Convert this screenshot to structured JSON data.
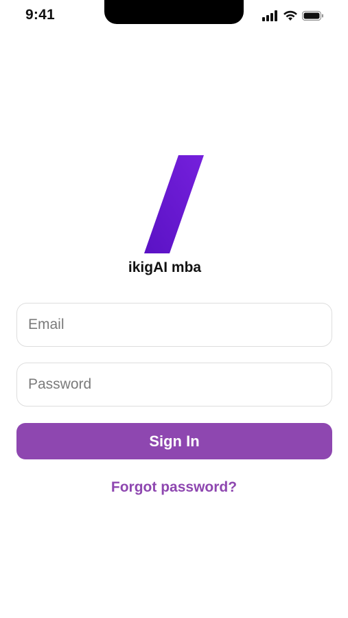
{
  "status_bar": {
    "time": "9:41",
    "icons": [
      "cellular-signal-icon",
      "wifi-icon",
      "battery-icon"
    ]
  },
  "brand": {
    "logo_icon": "slash-logo-icon",
    "name": "ikigAI mba",
    "logo_color": "#6a17d0"
  },
  "login_form": {
    "email_placeholder": "Email",
    "email_value": "",
    "password_placeholder": "Password",
    "password_value": "",
    "sign_in_label": "Sign In",
    "forgot_password_label": "Forgot password?"
  },
  "colors": {
    "accent": "#8e47b0",
    "text": "#111111",
    "field_border": "#dddddd"
  }
}
